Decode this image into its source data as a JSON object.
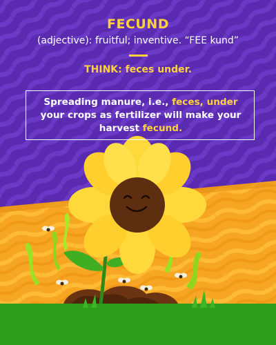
{
  "title": "FECUND",
  "definition": "(adjective): fruitful; inventive. “FEE kund”",
  "think": "THINK: feces under.",
  "mnemonic": {
    "line1_a": "Spreading manure, i.e., ",
    "line1_b": "feces, under",
    "line2": "your crops as fertilizer will make your",
    "line3_a": "harvest ",
    "line3_b": "fecund."
  },
  "colors": {
    "background_purple": "#5a2bb0",
    "stripe_purple": "#6a39c6",
    "accent_yellow": "#ffd23d",
    "field_orange": "#f5a623",
    "grass_green": "#2e9e1c",
    "petal_yellow": "#ffd93a",
    "flower_face": "#5e2e10",
    "sprout_green": "#9be224"
  },
  "icons": [
    "sunflower-smiling",
    "fly",
    "sprout",
    "manure-pile",
    "grass"
  ]
}
